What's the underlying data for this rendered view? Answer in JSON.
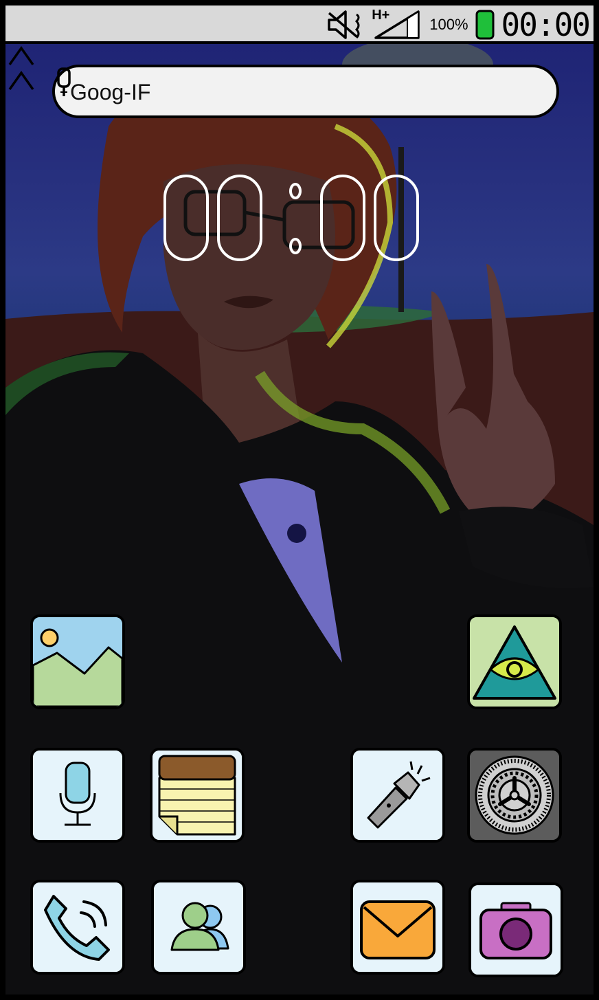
{
  "status_bar": {
    "network": "H+",
    "battery_percent": "100%",
    "battery_level": 1.0,
    "time": "00:00",
    "icons": [
      "mute-icon",
      "signal-icon",
      "battery-icon"
    ]
  },
  "search": {
    "label": "Goog-IF",
    "icon": "microphone-icon"
  },
  "clock": {
    "hours": "00",
    "minutes": "00"
  },
  "apps": {
    "gallery": "image-icon",
    "eye": "eye-pyramid-icon",
    "recorder": "microphone-icon",
    "notes": "notepad-icon",
    "flashlight": "flashlight-icon",
    "settings": "gear-icon",
    "phone": "phone-icon",
    "contacts": "contacts-icon",
    "drawer": "chevron-up-icon",
    "mail": "envelope-icon",
    "camera": "camera-icon"
  },
  "colors": {
    "tile_light": "#e6f4fb",
    "gallery_sky": "#9fd3ee",
    "gallery_hill": "#b6d99b",
    "sun": "#fdd06a",
    "eye_bg": "#c8e2a8",
    "eye_triangle": "#1f9a9a",
    "eye_iris": "#d6ea4a",
    "notes_top": "#8b5a2b",
    "notes_paper": "#f8f3b0",
    "mail": "#f9a83a",
    "camera": "#c86fc4",
    "settings_bg": "#5c5c5c"
  }
}
